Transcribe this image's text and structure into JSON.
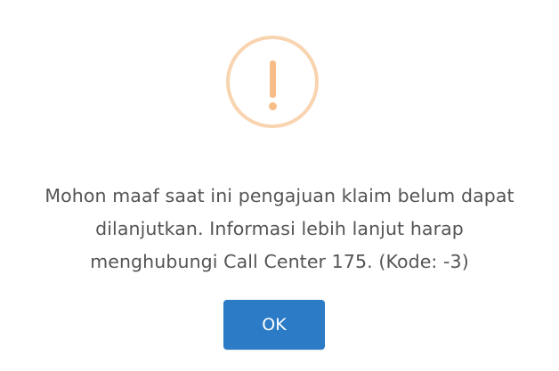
{
  "dialog": {
    "icon": "warning-exclamation-icon",
    "icon_colors": {
      "ring": "#f8d4b0",
      "mark": "#f6bd88"
    },
    "message_lines": [
      "Mohon maaf saat ini pengajuan klaim belum dapat",
      "dilanjutkan. Informasi lebih lanjut harap",
      "menghubungi Call Center 175. (Kode: -3)"
    ],
    "ok_label": "OK",
    "button_color": "#2b7bc6"
  }
}
